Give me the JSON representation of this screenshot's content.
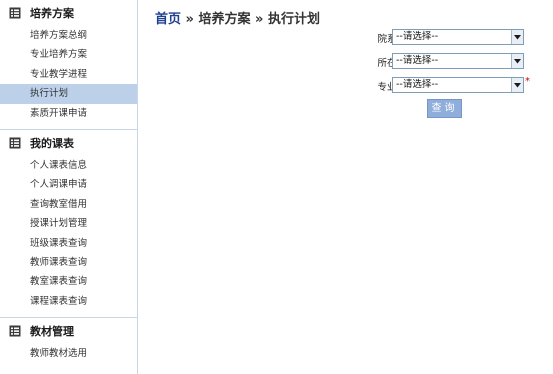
{
  "sidebar": {
    "sections": [
      {
        "title": "培养方案",
        "icon": "document-list-icon",
        "items": [
          "培养方案总纲",
          "专业培养方案",
          "专业教学进程",
          "执行计划",
          "素质开课申请"
        ],
        "active_index": 3
      },
      {
        "title": "我的课表",
        "icon": "document-list-icon",
        "items": [
          "个人课表信息",
          "个人调课申请",
          "查询教室借用",
          "授课计划管理",
          "班级课表查询",
          "教师课表查询",
          "教室课表查询",
          "课程课表查询"
        ]
      },
      {
        "title": "教材管理",
        "icon": "document-list-icon",
        "items": [
          "教师教材选用"
        ]
      }
    ]
  },
  "breadcrumb": {
    "home": "首页",
    "separator1": "»",
    "level1": "培养方案",
    "separator2": "»",
    "level2": "执行计划"
  },
  "form": {
    "department": {
      "label": "院系名称：",
      "value": "--请选择--"
    },
    "grade": {
      "label": "所在年级：",
      "value": "--请选择--"
    },
    "major": {
      "label": "专业名称：",
      "value": "--请选择--",
      "required_mark": "*"
    },
    "query_label": "查询"
  },
  "colors": {
    "active_item_bg": "#bcd0ea",
    "breadcrumb_home": "#1f3f8f",
    "button_bg": "#8faedc",
    "required": "#d40000"
  }
}
